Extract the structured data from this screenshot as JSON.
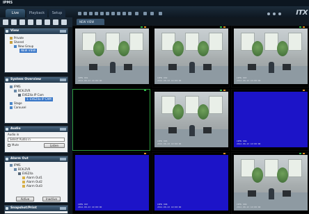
{
  "app": {
    "title": "IPMS"
  },
  "tabs": [
    {
      "label": "Live"
    },
    {
      "label": "Playback"
    },
    {
      "label": "Setup"
    }
  ],
  "logo": "ITX",
  "stream_tab": "NEW VIEW",
  "panels": {
    "view": {
      "title": "View",
      "items": [
        {
          "label": "Private"
        },
        {
          "label": "Shared"
        },
        {
          "label": "New Group"
        },
        {
          "label": "NEW VIEW"
        }
      ]
    },
    "system_overview": {
      "title": "System Overview",
      "items": [
        {
          "label": "IPMS"
        },
        {
          "label": "BCK-ZVR"
        },
        {
          "label": "EVEZ4a IP Cam"
        },
        {
          "label": "1. EVEZ4a IP CAM"
        },
        {
          "label": "Stage"
        },
        {
          "label": "Carousel"
        }
      ]
    },
    "audio": {
      "title": "Audio",
      "field_label": "Audio in",
      "select_value": "Select Audio in",
      "mute_label": "Mute",
      "button": "Listen"
    },
    "alarm_out": {
      "title": "Alarm Out",
      "items": [
        {
          "label": "IPMS"
        },
        {
          "label": "BCK-ZVR"
        },
        {
          "label": "EVEZ4a"
        },
        {
          "label": "Alarm Out1"
        },
        {
          "label": "Alarm Out2"
        },
        {
          "label": "Alarm Out3"
        }
      ],
      "buttons": [
        {
          "label": "Active"
        },
        {
          "label": "Inactive"
        }
      ]
    },
    "snapshot": {
      "title": "Snapshot/Print"
    }
  },
  "grid": {
    "cells": [
      {
        "type": "camera",
        "osd1": "IPMS 001",
        "osd2": "2012-08-23 10:00:00"
      },
      {
        "type": "camera",
        "osd1": "IPMS 002",
        "osd2": "2012-08-23 10:00:00"
      },
      {
        "type": "camera",
        "osd1": "IPMS 003",
        "osd2": "2012-08-23 10:00:00"
      },
      {
        "type": "black",
        "osd1": "",
        "osd2": ""
      },
      {
        "type": "camera",
        "osd1": "IPMS 005",
        "osd2": "2012-08-23 10:00:00"
      },
      {
        "type": "blue",
        "osd1": "IPMS 006",
        "osd2": "2012-08-23 10:00:00"
      },
      {
        "type": "blue",
        "osd1": "IPMS 007",
        "osd2": "2012-08-23 10:00:00"
      },
      {
        "type": "blue",
        "osd1": "IPMS 008",
        "osd2": "2012-08-23 10:00:00"
      },
      {
        "type": "camera",
        "osd1": "IPMS 009",
        "osd2": "2012-08-23 10:00:00"
      }
    ]
  },
  "colors": {
    "accent": "#3a78c8",
    "no_signal": "#1c14c8",
    "selected_border": "#2e9c3e"
  }
}
